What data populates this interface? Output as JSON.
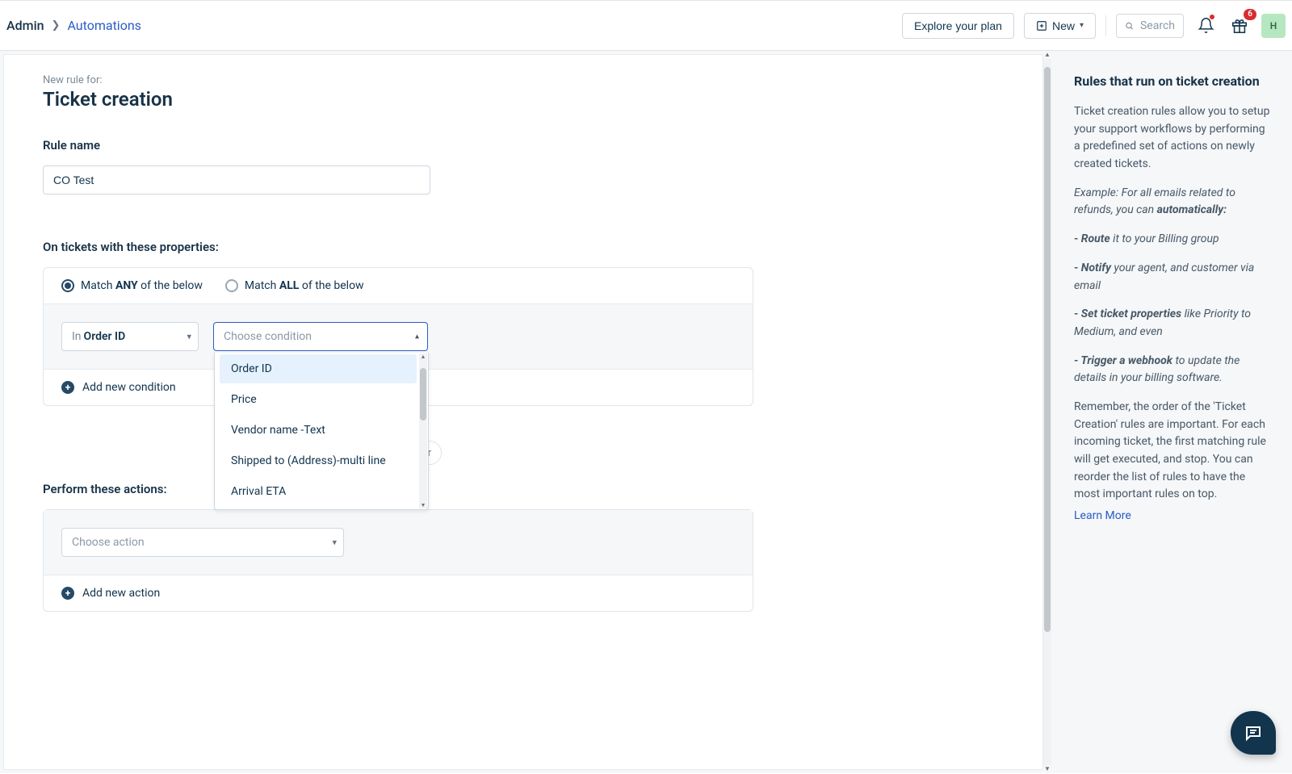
{
  "header": {
    "breadcrumb_admin": "Admin",
    "breadcrumb_automations": "Automations",
    "explore_label": "Explore your plan",
    "new_label": "New",
    "search_placeholder": "Search",
    "gift_badge": "6",
    "avatar_letter": "H"
  },
  "main": {
    "superscript": "New rule for:",
    "title": "Ticket creation",
    "rule_name_label": "Rule name",
    "rule_name_value": "CO Test",
    "props_label": "On tickets with these properties:",
    "match_any_pre": "Match ",
    "match_any_bold": "ANY",
    "match_any_post": " of the below",
    "match_all_pre": "Match ",
    "match_all_bold": "ALL",
    "match_all_post": " of the below",
    "in_prefix": "In ",
    "in_value": "Order ID",
    "condition_placeholder": "Choose condition",
    "dropdown": [
      "Order ID",
      "Price",
      "Vendor name -Text",
      "Shipped to (Address)-multi line",
      "Arrival ETA"
    ],
    "add_condition": "Add new condition",
    "pill_text": "r",
    "actions_label": "Perform these actions:",
    "action_placeholder": "Choose action",
    "add_action": "Add new action"
  },
  "side": {
    "title": "Rules that run on ticket creation",
    "p1": "Ticket creation rules allow you to setup your support workflows by performing a predefined set of actions on newly created tickets.",
    "p2_pre": "Example: For all emails related to refunds, you can ",
    "p2_bold": "automatically:",
    "route_bold": "- Route",
    "route_rest": " it to your Billing group",
    "notify_bold": "- Notify",
    "notify_rest": " your agent, and customer via email",
    "setprops_bold": "- Set ticket properties",
    "setprops_rest": " like Priority to Medium, and even",
    "trigger_bold": "- Trigger a webhook",
    "trigger_rest": " to update the details in your billing software.",
    "p3": "Remember, the order of the 'Ticket Creation' rules are important. For each incoming ticket, the first matching rule will get executed, and stop. You can reorder the list of rules to have the most important rules on top.",
    "learn_more": "Learn More"
  }
}
